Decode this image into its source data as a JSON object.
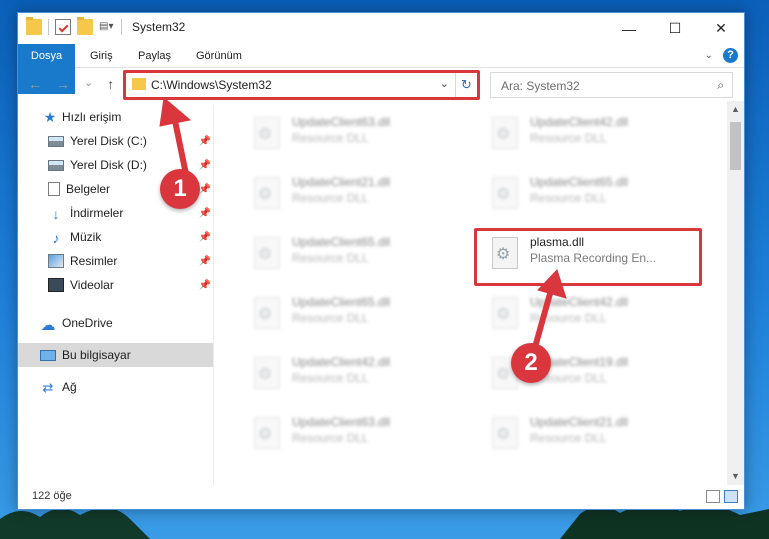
{
  "window": {
    "title": "System32",
    "controls": {
      "minimize": "—",
      "maximize": "☐",
      "close": "✕"
    }
  },
  "ribbon": {
    "tabs": [
      "Dosya",
      "Giriş",
      "Paylaş",
      "Görünüm"
    ],
    "help": "?"
  },
  "navigation": {
    "address": "C:\\Windows\\System32",
    "search_placeholder": "Ara: System32",
    "back": "←",
    "forward": "→",
    "recent": "⌄",
    "up": "↑",
    "refresh": "↻",
    "search_icon": "⌕",
    "dropdown": "⌄"
  },
  "sidebar": {
    "quick_access": "Hızlı erişim",
    "items": [
      {
        "label": "Yerel Disk (C:)",
        "icon": "drive-icon",
        "pinned": true
      },
      {
        "label": "Yerel Disk (D:)",
        "icon": "drive-icon",
        "pinned": true
      },
      {
        "label": "Belgeler",
        "icon": "documents-icon",
        "pinned": true
      },
      {
        "label": "İndirmeler",
        "icon": "download-icon",
        "pinned": true
      },
      {
        "label": "Müzik",
        "icon": "music-icon",
        "pinned": true
      },
      {
        "label": "Resimler",
        "icon": "pictures-icon",
        "pinned": true
      },
      {
        "label": "Videolar",
        "icon": "videos-icon",
        "pinned": true
      }
    ],
    "onedrive": "OneDrive",
    "this_pc": "Bu bilgisayar",
    "network": "Ağ",
    "pin_glyph": "📌"
  },
  "files": {
    "left_column": [
      {
        "name": "UpdateClient63.dll",
        "desc": "Resource DLL"
      },
      {
        "name": "UpdateClient21.dll",
        "desc": "Resource DLL"
      },
      {
        "name": "UpdateClient65.dll",
        "desc": "Resource DLL"
      },
      {
        "name": "UpdateClient65.dll",
        "desc": "Resource DLL"
      },
      {
        "name": "UpdateClient42.dll",
        "desc": "Resource DLL"
      },
      {
        "name": "UpdateClient63.dll",
        "desc": "Resource DLL"
      }
    ],
    "right_column": [
      {
        "name": "UpdateClient42.dll",
        "desc": "Resource DLL"
      },
      {
        "name": "UpdateClient65.dll",
        "desc": "Resource DLL"
      },
      {
        "name": "plasma.dll",
        "desc": "Plasma Recording En..."
      },
      {
        "name": "UpdateClient42.dll",
        "desc": "Resource DLL"
      },
      {
        "name": "UpdateClient19.dll",
        "desc": "Resource DLL"
      },
      {
        "name": "UpdateClient21.dll",
        "desc": "Resource DLL"
      }
    ]
  },
  "status": {
    "item_count": "122 öğe"
  },
  "annotations": {
    "step1": "1",
    "step2": "2",
    "color": "#d9363e"
  }
}
